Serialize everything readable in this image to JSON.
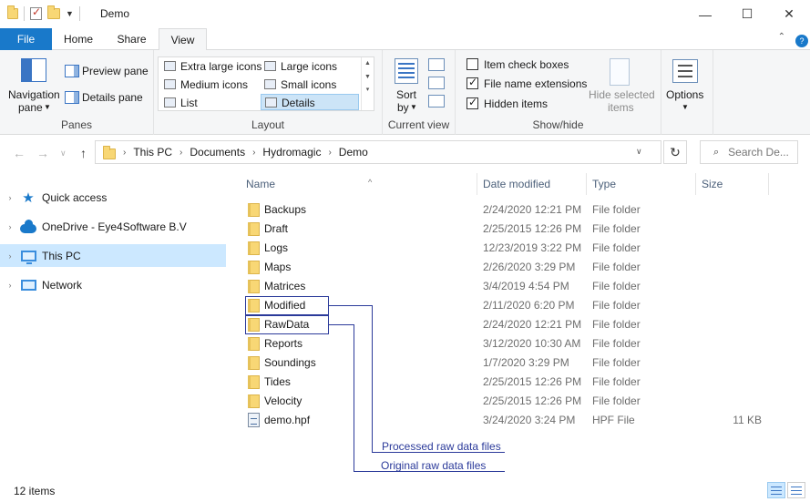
{
  "window": {
    "title": "Demo",
    "controls": {
      "minimize": "—",
      "maximize": "☐",
      "close": "✕"
    }
  },
  "ribbon_tabs": [
    {
      "label": "File"
    },
    {
      "label": "Home"
    },
    {
      "label": "Share"
    },
    {
      "label": "View"
    }
  ],
  "ribbon": {
    "panes": {
      "label": "Panes",
      "navigation_pane_line1": "Navigation",
      "navigation_pane_line2": "pane",
      "preview_pane": "Preview pane",
      "details_pane": "Details pane"
    },
    "layout": {
      "label": "Layout",
      "items": [
        "Extra large icons",
        "Large icons",
        "Medium icons",
        "Small icons",
        "List",
        "Details"
      ],
      "selected": "Details"
    },
    "current_view": {
      "label": "Current view",
      "sort_by_line1": "Sort",
      "sort_by_line2": "by"
    },
    "show_hide": {
      "label": "Show/hide",
      "item_check_boxes": "Item check boxes",
      "file_name_extensions": "File name extensions",
      "hidden_items": "Hidden items",
      "hide_selected_line1": "Hide selected",
      "hide_selected_line2": "items",
      "checks": {
        "item_check_boxes": false,
        "file_name_extensions": true,
        "hidden_items": true
      }
    },
    "options": {
      "label": "Options"
    }
  },
  "address": {
    "segments": [
      "This PC",
      "Documents",
      "Hydromagic",
      "Demo"
    ],
    "search_placeholder": "Search De..."
  },
  "nav_pane": {
    "items": [
      {
        "label": "Quick access",
        "icon": "star-icon"
      },
      {
        "label": "OneDrive - Eye4Software B.V",
        "icon": "cloud-icon"
      },
      {
        "label": "This PC",
        "icon": "computer-icon",
        "selected": true
      },
      {
        "label": "Network",
        "icon": "network-icon"
      }
    ]
  },
  "columns": {
    "name": "Name",
    "date": "Date modified",
    "type": "Type",
    "size": "Size"
  },
  "files": [
    {
      "name": "Backups",
      "date": "2/24/2020 12:21 PM",
      "type": "File folder",
      "size": ""
    },
    {
      "name": "Draft",
      "date": "2/25/2015 12:26 PM",
      "type": "File folder",
      "size": ""
    },
    {
      "name": "Logs",
      "date": "12/23/2019 3:22 PM",
      "type": "File folder",
      "size": ""
    },
    {
      "name": "Maps",
      "date": "2/26/2020 3:29 PM",
      "type": "File folder",
      "size": ""
    },
    {
      "name": "Matrices",
      "date": "3/4/2019 4:54 PM",
      "type": "File folder",
      "size": ""
    },
    {
      "name": "Modified",
      "date": "2/11/2020 6:20 PM",
      "type": "File folder",
      "size": ""
    },
    {
      "name": "RawData",
      "date": "2/24/2020 12:21 PM",
      "type": "File folder",
      "size": ""
    },
    {
      "name": "Reports",
      "date": "3/12/2020 10:30 AM",
      "type": "File folder",
      "size": ""
    },
    {
      "name": "Soundings",
      "date": "1/7/2020 3:29 PM",
      "type": "File folder",
      "size": ""
    },
    {
      "name": "Tides",
      "date": "2/25/2015 12:26 PM",
      "type": "File folder",
      "size": ""
    },
    {
      "name": "Velocity",
      "date": "2/25/2015 12:26 PM",
      "type": "File folder",
      "size": ""
    },
    {
      "name": "demo.hpf",
      "date": "3/24/2020 3:24 PM",
      "type": "HPF File",
      "size": "11 KB"
    }
  ],
  "annotations": {
    "processed": "Processed raw data files",
    "original": "Original raw data files",
    "color": "#2b3a9a"
  },
  "status": {
    "count": "12 items"
  }
}
